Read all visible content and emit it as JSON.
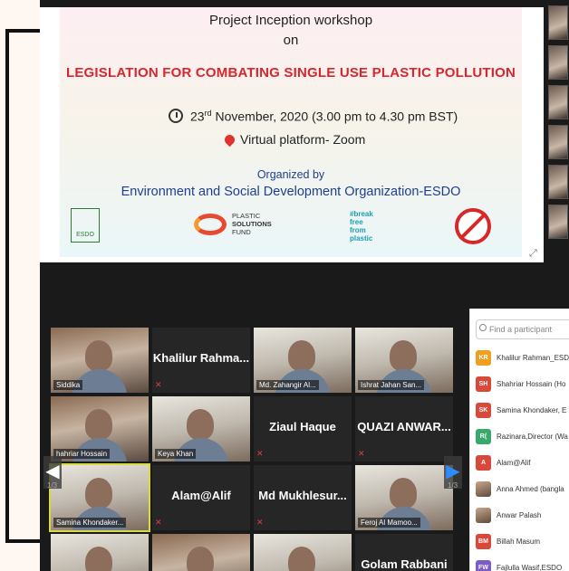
{
  "slide": {
    "line1": "Project Inception workshop",
    "line2": "on",
    "title": "LEGISLATION FOR COMBATING SINGLE USE PLASTIC POLLUTION",
    "date_pre": "23",
    "date_sup": "rd",
    "date_post": " November, 2020 (3.00 pm to 4.30 pm BST)",
    "venue": "Virtual platform- Zoom",
    "org_label": "Organized by",
    "org_name": "Environment and Social Development Organization-ESDO",
    "logo_esdo": "ESDO",
    "psf_1": "PLASTIC",
    "psf_2": "SOLUTIONS",
    "psf_3": "FUND",
    "break_1": "#break",
    "break_2": "free",
    "break_3": "from",
    "break_4": "plastic"
  },
  "gallery": {
    "tiles": [
      {
        "name": "",
        "label": "Siddika"
      },
      {
        "name": "Khalilur Rahma...",
        "label": ""
      },
      {
        "name": "",
        "label": "Md. Zahangir Al..."
      },
      {
        "name": "",
        "label": "Ishrat Jahan San..."
      },
      {
        "name": "",
        "label": "hahriar Hossain"
      },
      {
        "name": "",
        "label": "Keya Khan"
      },
      {
        "name": "Ziaul Haque",
        "label": ""
      },
      {
        "name": "QUAZI ANWAR...",
        "label": ""
      },
      {
        "name": "",
        "label": "Samina Khondaker..."
      },
      {
        "name": "Alam@Alif",
        "label": ""
      },
      {
        "name": "Md Mukhlesur...",
        "label": ""
      },
      {
        "name": "",
        "label": "Feroj Al Mamoo..."
      },
      {
        "name": "",
        "label": ""
      },
      {
        "name": "",
        "label": ""
      },
      {
        "name": "",
        "label": ""
      },
      {
        "name": "Golam Rabbani",
        "label": ""
      }
    ],
    "page_left": "1/3",
    "page_right": "1/3"
  },
  "participants": {
    "search_placeholder": "Find a participant",
    "items": [
      {
        "initials": "KR",
        "color": "#f0a020",
        "name": "Khalilur Rahman_ESD"
      },
      {
        "initials": "SH",
        "color": "#d9493a",
        "name": "Shahriar Hossain (Ho"
      },
      {
        "initials": "SK",
        "color": "#d9493a",
        "name": "Samina Khondaker, E"
      },
      {
        "initials": "R(",
        "color": "#3aa86b",
        "name": "Razinara,Director (Wa"
      },
      {
        "initials": "A",
        "color": "#d9493a",
        "name": "Alam@Alif"
      },
      {
        "initials": "",
        "color": "",
        "name": "Anna Ahmed (bangla"
      },
      {
        "initials": "",
        "color": "",
        "name": "Anwar Palash"
      },
      {
        "initials": "BM",
        "color": "#d9493a",
        "name": "Billah Masum"
      },
      {
        "initials": "FW",
        "color": "#7b5cc9",
        "name": "Fajlulla Wasif,ESDO"
      }
    ]
  }
}
